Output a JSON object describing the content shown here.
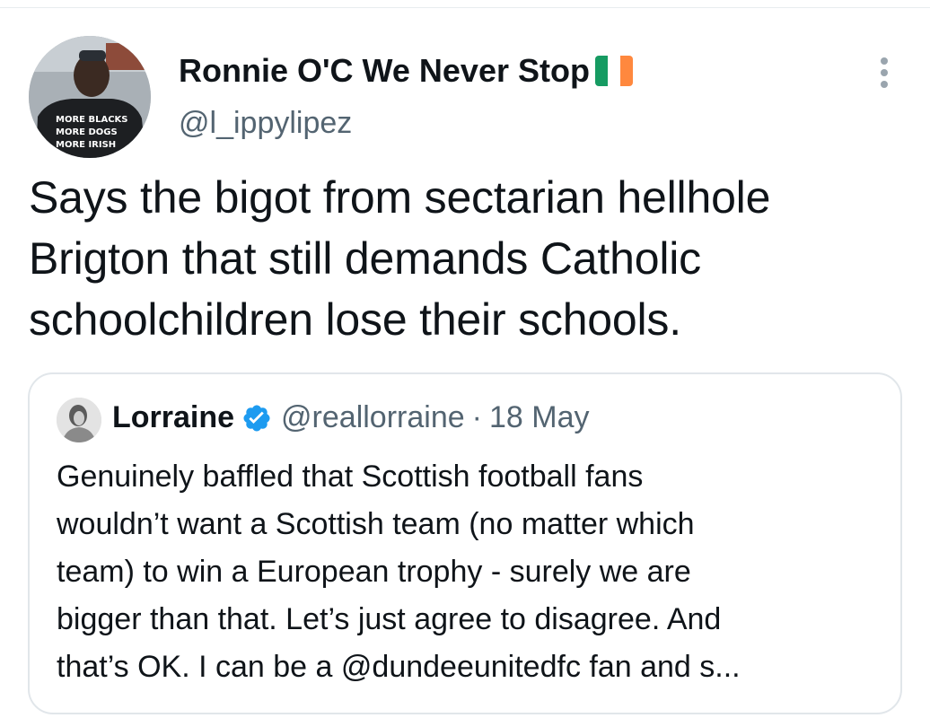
{
  "tweet": {
    "author_name": "Ronnie O'C We Never Stop",
    "author_handle": "@l_ippylipez",
    "avatar_shirt_text": [
      "MORE BLACKS",
      "MORE DOGS",
      "MORE IRISH"
    ],
    "flag_colors": [
      "#169b62",
      "#ffffff",
      "#ff883e"
    ],
    "text_lines": [
      "Says the bigot from sectarian hellhole",
      "Brigton that still demands Catholic",
      "schoolchildren lose their schools."
    ],
    "more_icon": "more-vertical-icon"
  },
  "quote": {
    "author_name": "Lorraine",
    "verified_icon": "verified-badge-icon",
    "verified_color": "#1d9bf0",
    "author_handle": "@reallorraine",
    "separator": "·",
    "date": "18 May",
    "text_lines": [
      "Genuinely baffled that Scottish football fans",
      "wouldn’t want a Scottish team (no matter which",
      "team) to win a European trophy - surely we are",
      "bigger than that. Let’s just agree to disagree. And",
      "that’s OK. I can be a @dundeeunitedfc fan and s..."
    ]
  }
}
